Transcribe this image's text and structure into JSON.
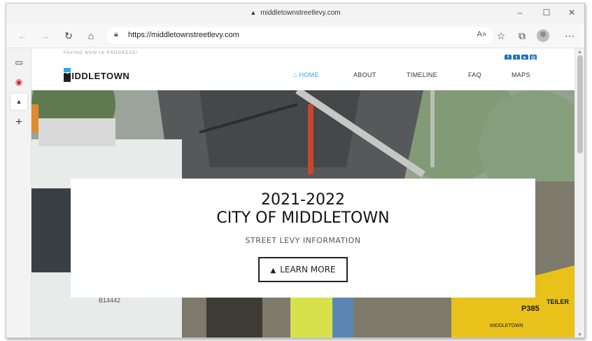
{
  "browser": {
    "title": "middletownstreetlevy.com",
    "url": "https://middletownstreetlevy.com",
    "controls": {
      "minimize": "–",
      "maximize": "☐",
      "close": "✕"
    },
    "toolbar_icons": [
      "back-icon",
      "forward-icon",
      "refresh-icon",
      "home-icon",
      "lock-icon",
      "read-aloud-icon",
      "favorites-icon",
      "collections-icon",
      "profile-icon",
      "more-icon"
    ],
    "sidebar_icons": [
      "tabs-icon",
      "collections-red-icon",
      "site-icon",
      "add-icon"
    ]
  },
  "site": {
    "topbar": {
      "notice": "PAVING NOW IN PROGRESS!"
    },
    "social_icons": [
      "facebook-icon",
      "twitter-icon",
      "youtube-icon",
      "instagram-icon"
    ],
    "logo": {
      "text": "MIDDLETOWN"
    },
    "nav": [
      {
        "label": "HOME",
        "icon": "home-icon",
        "active": true
      },
      {
        "label": "ABOUT",
        "active": false
      },
      {
        "label": "TIMELINE",
        "active": false
      },
      {
        "label": "FAQ",
        "active": false
      },
      {
        "label": "MAPS",
        "active": false
      }
    ],
    "hero": {
      "year": "2021-2022",
      "title": "CITY OF MIDDLETOWN",
      "subtitle": "STREET LEVY INFORMATION",
      "button": "LEARN MORE",
      "photo_text": {
        "truck_number": "B14442",
        "machine_model": "P385",
        "machine_brand": "TEILER",
        "machine_owner": "MIDDLETOWN"
      }
    }
  },
  "colors": {
    "accent": "#29a9e1",
    "social": "#1f6fbf",
    "machine": "#e8c21a"
  }
}
